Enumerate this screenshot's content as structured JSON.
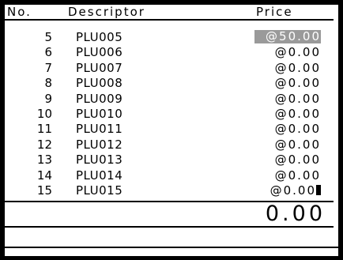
{
  "header": {
    "no": "No.",
    "descriptor": "Descriptor",
    "price": "Price"
  },
  "rows": [
    {
      "no": "5",
      "descriptor": "PLU005",
      "price": "@50.00",
      "selected": true
    },
    {
      "no": "6",
      "descriptor": "PLU006",
      "price": "@0.00"
    },
    {
      "no": "7",
      "descriptor": "PLU007",
      "price": "@0.00"
    },
    {
      "no": "8",
      "descriptor": "PLU008",
      "price": "@0.00"
    },
    {
      "no": "9",
      "descriptor": "PLU009",
      "price": "@0.00"
    },
    {
      "no": "10",
      "descriptor": "PLU010",
      "price": "@0.00"
    },
    {
      "no": "11",
      "descriptor": "PLU011",
      "price": "@0.00"
    },
    {
      "no": "12",
      "descriptor": "PLU012",
      "price": "@0.00"
    },
    {
      "no": "13",
      "descriptor": "PLU013",
      "price": "@0.00"
    },
    {
      "no": "14",
      "descriptor": "PLU014",
      "price": "@0.00"
    },
    {
      "no": "15",
      "descriptor": "PLU015",
      "price": "@0.00",
      "cursor": true
    }
  ],
  "total": "0.00",
  "colors": {
    "background": "#000000",
    "screen": "#ffffff",
    "selection": "#9a9a9a"
  }
}
